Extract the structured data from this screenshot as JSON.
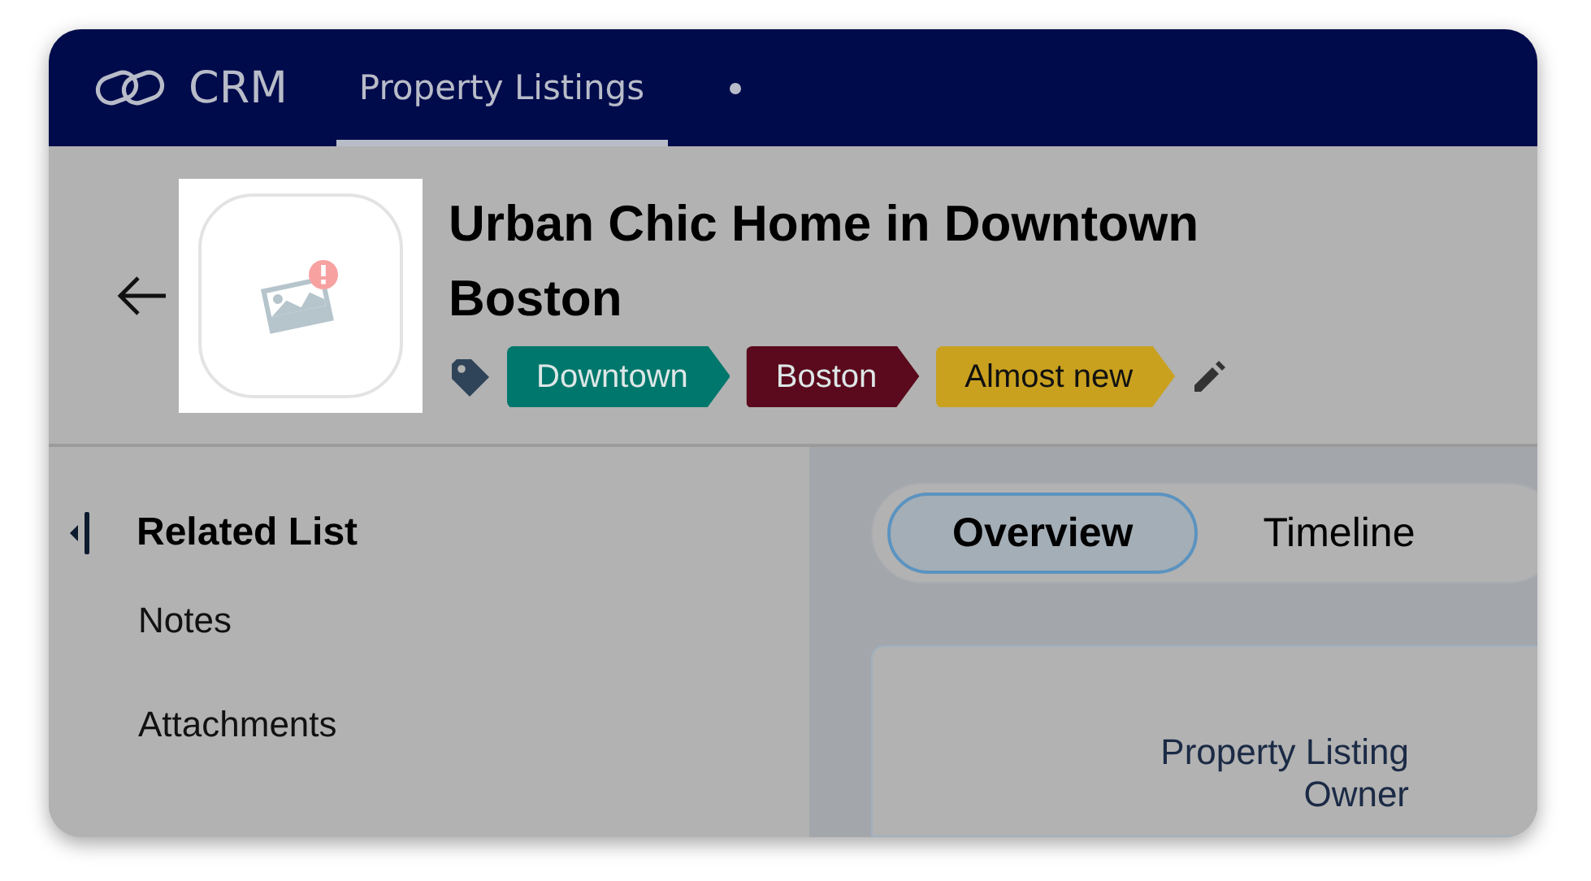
{
  "app": {
    "name": "CRM"
  },
  "nav_tabs": [
    {
      "label": "Property Listings",
      "selected": true
    }
  ],
  "record": {
    "title": "Urban Chic Home in Downtown Boston",
    "tags": [
      {
        "label": "Downtown",
        "color": "#00776c"
      },
      {
        "label": "Boston",
        "color": "#5a0a1c"
      },
      {
        "label": "Almost new",
        "color": "#c9a11f"
      }
    ]
  },
  "sidebar": {
    "heading": "Related List",
    "items": [
      {
        "label": "Notes"
      },
      {
        "label": "Attachments"
      }
    ]
  },
  "view_tabs": [
    {
      "label": "Overview",
      "selected": true
    },
    {
      "label": "Timeline",
      "selected": false
    }
  ],
  "details": {
    "fields": [
      {
        "label": "Property Listing Owner"
      }
    ]
  }
}
